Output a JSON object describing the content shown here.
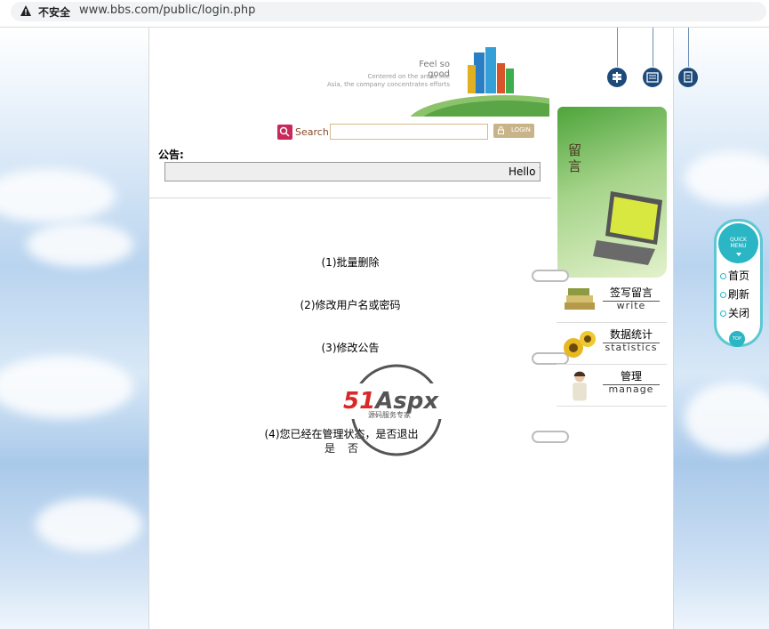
{
  "browser": {
    "security_label": "不安全",
    "url": "www.bbs.com/public/login.php"
  },
  "header": {
    "slogan": "Feel so good",
    "tagline_1": "Centered on the areas like",
    "tagline_2": "Asia, the company concentrates efforts"
  },
  "search": {
    "label": "Search",
    "value": "",
    "login_label": "LOGIN"
  },
  "notice": {
    "label": "公告:",
    "text": "Hello W"
  },
  "menu": {
    "item1": "(1)批量删除",
    "item2": "(2)修改用户名或密码",
    "item3": "(3)修改公告",
    "item4": "(4)您已经在管理状态，是否退出",
    "yes": "是",
    "no": "否"
  },
  "watermark": {
    "brand": "51Aspx",
    "sub": "源码服务专家"
  },
  "right_panel": {
    "panel_title": "留言",
    "nav": [
      {
        "cn": "签写留言",
        "en": "write",
        "icon": "books-icon"
      },
      {
        "cn": "数据统计",
        "en": "statistics",
        "icon": "sunflower-icon"
      },
      {
        "cn": "管理",
        "en": "manage",
        "icon": "person-icon"
      }
    ]
  },
  "quick_menu": {
    "title_1": "QUICK",
    "title_2": "MENU",
    "items": [
      "首页",
      "刷新",
      "关闭"
    ],
    "top": "TOP"
  },
  "colors": {
    "quick_accent": "#2ab6c4",
    "search_icon": "#c8285a",
    "login_button": "#c9b489"
  }
}
